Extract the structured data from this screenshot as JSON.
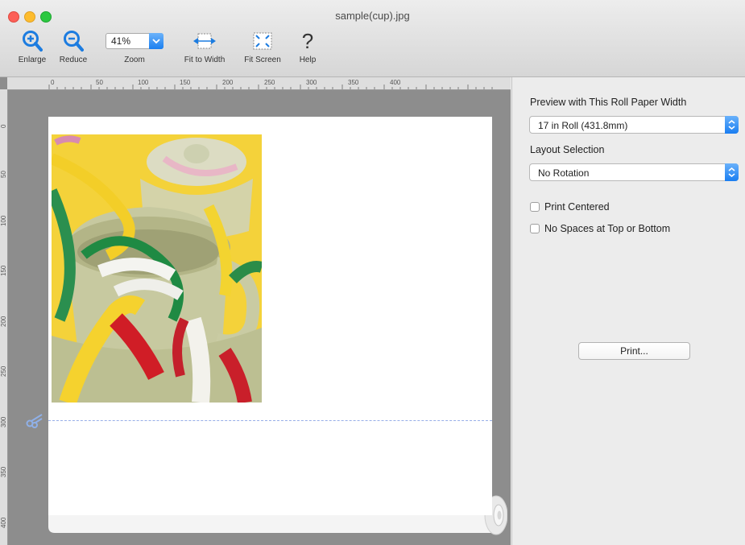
{
  "window": {
    "title": "sample(cup).jpg"
  },
  "toolbar": {
    "enlarge_label": "Enlarge",
    "reduce_label": "Reduce",
    "zoom_label": "Zoom",
    "zoom_value": "41%",
    "fit_width_label": "Fit to Width",
    "fit_screen_label": "Fit Screen",
    "help_label": "Help"
  },
  "ruler": {
    "top_ticks": [
      "0",
      "50",
      "100",
      "150",
      "200",
      "250",
      "300",
      "350",
      "400"
    ],
    "left_ticks": [
      "0",
      "50",
      "100",
      "150",
      "200",
      "250",
      "300",
      "350",
      "400"
    ]
  },
  "panel": {
    "roll_width_label": "Preview with This Roll Paper Width",
    "roll_width_value": "17 in Roll (431.8mm)",
    "layout_label": "Layout Selection",
    "layout_value": "No Rotation",
    "print_centered_label": "Print Centered",
    "print_centered_checked": false,
    "no_spaces_label": "No Spaces at Top or Bottom",
    "no_spaces_checked": false,
    "print_button_label": "Print..."
  },
  "colors": {
    "accent_blue": "#1b7ff0",
    "toolbar_icon_blue": "#1c7ce0",
    "close_red": "#fc5f57",
    "minimize_yellow": "#fdbc2e",
    "maximize_green": "#2bc840"
  },
  "icons": {
    "enlarge": "zoom-in-magnifier-icon",
    "reduce": "zoom-out-magnifier-icon",
    "fit_width": "fit-width-icon",
    "fit_screen": "fit-screen-icon",
    "help": "question-mark-icon",
    "cut": "scissors-icon"
  }
}
